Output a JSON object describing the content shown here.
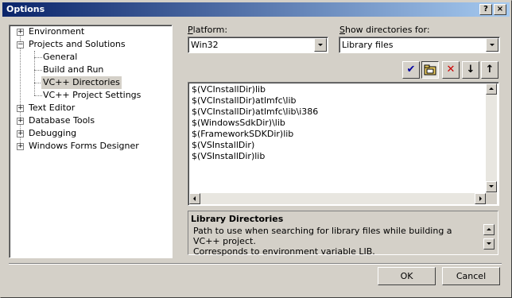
{
  "window": {
    "title": "Options",
    "help_glyph": "?",
    "close_glyph": "×"
  },
  "tree": {
    "items": [
      {
        "label": "Environment",
        "expander": "+"
      },
      {
        "label": "Projects and Solutions",
        "expander": "−"
      },
      {
        "label": "General"
      },
      {
        "label": "Build and Run"
      },
      {
        "label": "VC++ Directories",
        "selected": true
      },
      {
        "label": "VC++ Project Settings"
      },
      {
        "label": "Text Editor",
        "expander": "+"
      },
      {
        "label": "Database Tools",
        "expander": "+"
      },
      {
        "label": "Debugging",
        "expander": "+"
      },
      {
        "label": "Windows Forms Designer",
        "expander": "+"
      }
    ]
  },
  "platform": {
    "label_first": "P",
    "label_rest": "latform:",
    "value": "Win32"
  },
  "show_dirs": {
    "label_first": "S",
    "label_rest": "how directories for:",
    "value": "Library files"
  },
  "toolbar": {
    "check_glyph": "✔",
    "new_folder_glyph": "▭",
    "delete_glyph": "✕",
    "move_down_glyph": "↓",
    "move_up_glyph": "↑"
  },
  "directories": [
    "$(VCInstallDir)lib",
    "$(VCInstallDir)atlmfc\\lib",
    "$(VCInstallDir)atlmfc\\lib\\i386",
    "$(WindowsSdkDir)\\lib",
    "$(FrameworkSDKDir)lib",
    "$(VSInstallDir)",
    "$(VSInstallDir)lib"
  ],
  "description": {
    "title": "Library Directories",
    "line1": "Path to use when searching for library files while building a VC++ project.",
    "line2": "Corresponds to environment variable LIB."
  },
  "buttons": {
    "ok": "OK",
    "cancel": "Cancel"
  },
  "colors": {
    "title_start": "#0a246a",
    "title_end": "#a6caf0",
    "face": "#d4d0c8",
    "delete_red": "#cc0000",
    "check_blue": "#0000a0"
  }
}
